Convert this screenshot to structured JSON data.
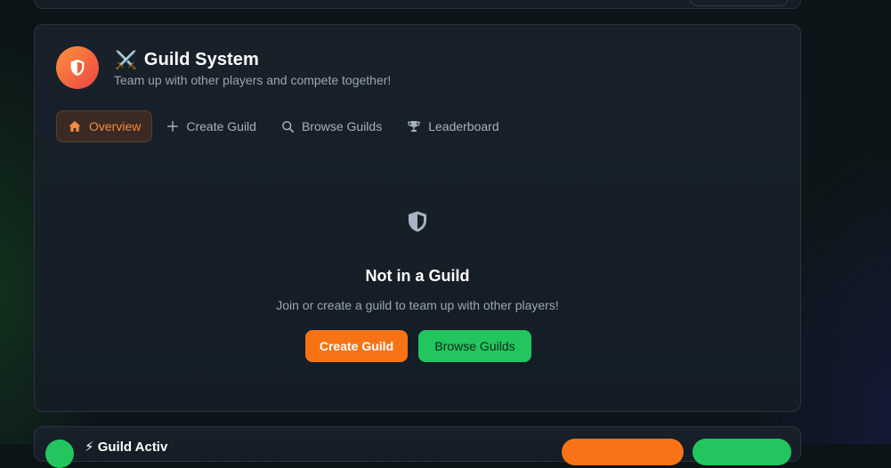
{
  "header": {
    "emoji": "⚔️",
    "title": "Guild System",
    "subtitle": "Team up with other players and compete together!"
  },
  "tabs": [
    {
      "label": "Overview",
      "icon": "home-icon",
      "active": true
    },
    {
      "label": "Create Guild",
      "icon": "plus-icon",
      "active": false
    },
    {
      "label": "Browse Guilds",
      "icon": "search-icon",
      "active": false
    },
    {
      "label": "Leaderboard",
      "icon": "trophy-icon",
      "active": false
    }
  ],
  "empty_state": {
    "icon": "shield-icon",
    "title": "Not in a Guild",
    "description": "Join or create a guild to team up with other players!",
    "create_button": "Create Guild",
    "browse_button": "Browse Guilds"
  },
  "bottom_card": {
    "title": "⚡ Guild Activ"
  },
  "colors": {
    "accent_orange": "#f97316",
    "accent_green": "#22c55e",
    "card_bg": "#18212b",
    "page_bg": "#0e1619"
  }
}
